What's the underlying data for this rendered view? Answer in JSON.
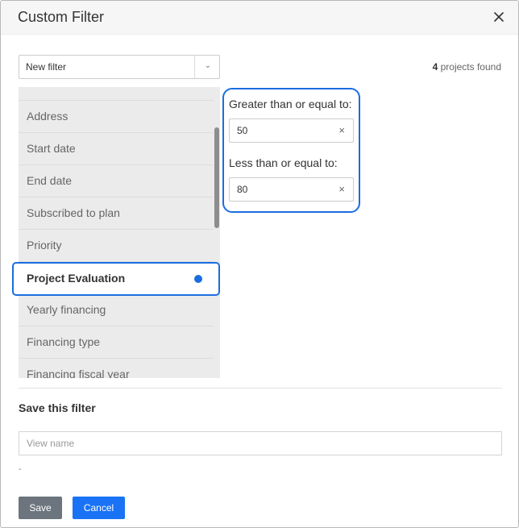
{
  "dialog": {
    "title": "Custom Filter",
    "close_icon": "close-icon"
  },
  "filter_select": {
    "value": "New filter",
    "arrow_icon": "chevron-down-icon"
  },
  "results": {
    "count": "4",
    "label": " projects found"
  },
  "field_list": {
    "items": [
      {
        "label": "Address"
      },
      {
        "label": "Start date"
      },
      {
        "label": "End date"
      },
      {
        "label": "Subscribed to plan"
      },
      {
        "label": "Priority"
      },
      {
        "label": "Project Evaluation",
        "selected": true
      },
      {
        "label": "Yearly financing"
      },
      {
        "label": "Financing type"
      },
      {
        "label": "Financing fiscal year"
      }
    ],
    "selected_label": "Project Evaluation"
  },
  "range": {
    "min_label": "Greater than or equal to:",
    "min_value": "50",
    "max_label": "Less than or equal to:",
    "max_value": "80",
    "clear_glyph": "×"
  },
  "save_section": {
    "title": "Save this filter",
    "view_name_placeholder": "View name",
    "view_name_value": "",
    "dash": "-"
  },
  "buttons": {
    "save": "Save",
    "cancel": "Cancel"
  },
  "colors": {
    "accent": "#1a6de0",
    "save_button": "#6c757d",
    "cancel_button": "#1a73f5"
  }
}
